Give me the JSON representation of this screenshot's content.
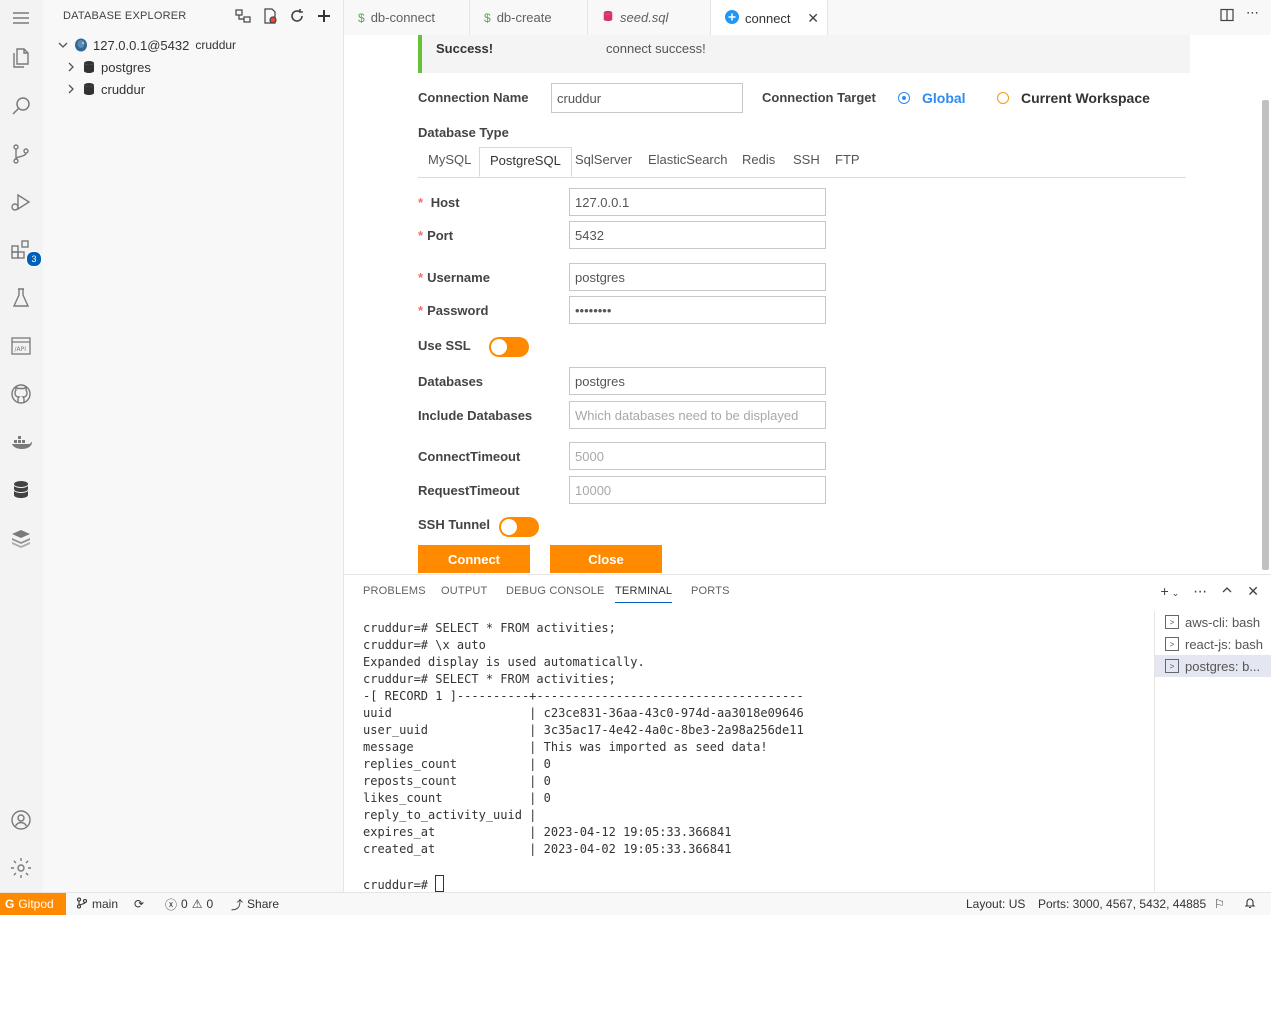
{
  "sidebar": {
    "title": "DATABASE EXPLORER",
    "connection": {
      "host": "127.0.0.1@5432",
      "db": "cruddur"
    },
    "children": [
      "postgres",
      "cruddur"
    ]
  },
  "tabs": [
    {
      "label": "db-connect",
      "icon": "dollar-icon",
      "active": false
    },
    {
      "label": "db-create",
      "icon": "dollar-icon",
      "active": false
    },
    {
      "label": "seed.sql",
      "icon": "database-icon",
      "active": false
    },
    {
      "label": "connect",
      "icon": "plus-circle-icon",
      "active": true
    }
  ],
  "activity_badge": "3",
  "alert": {
    "title": "Success!",
    "message": "connect success!"
  },
  "form": {
    "connection_name_label": "Connection Name",
    "connection_name_value": "cruddur",
    "connection_target_label": "Connection Target",
    "target_global": "Global",
    "target_workspace": "Current Workspace",
    "database_type_label": "Database Type",
    "db_types": [
      "MySQL",
      "PostgreSQL",
      "SqlServer",
      "ElasticSearch",
      "Redis",
      "SSH",
      "FTP"
    ],
    "active_db_type": "PostgreSQL",
    "host_label": "Host",
    "host_value": "127.0.0.1",
    "port_label": "Port",
    "port_value": "5432",
    "username_label": "Username",
    "username_value": "postgres",
    "password_label": "Password",
    "password_value": "••••••••",
    "ssl_label": "Use SSL",
    "databases_label": "Databases",
    "databases_value": "postgres",
    "include_label": "Include Databases",
    "include_placeholder": "Which databases need to be displayed",
    "connect_timeout_label": "ConnectTimeout",
    "connect_timeout_value": "5000",
    "request_timeout_label": "RequestTimeout",
    "request_timeout_value": "10000",
    "ssh_label": "SSH Tunnel",
    "connect_button": "Connect",
    "close_button": "Close"
  },
  "panel": {
    "tabs": [
      "PROBLEMS",
      "OUTPUT",
      "DEBUG CONSOLE",
      "TERMINAL",
      "PORTS"
    ],
    "active_tab": "TERMINAL",
    "terminal_lines": [
      "cruddur=# SELECT * FROM activities;",
      "cruddur=# \\x auto",
      "Expanded display is used automatically.",
      "cruddur=# SELECT * FROM activities;",
      "-[ RECORD 1 ]----------+-------------------------------------",
      "uuid                   | c23ce831-36aa-43c0-974d-aa3018e09646",
      "user_uuid              | 3c35ac17-4e42-4a0c-8be3-2a98a256de11",
      "message                | This was imported as seed data!",
      "replies_count          | 0",
      "reposts_count          | 0",
      "likes_count            | 0",
      "reply_to_activity_uuid | ",
      "expires_at             | 2023-04-12 19:05:33.366841",
      "created_at             | 2023-04-02 19:05:33.366841",
      ""
    ],
    "prompt": "cruddur=# ",
    "terminals": [
      "aws-cli: bash",
      "react-js: bash",
      "postgres: b..."
    ]
  },
  "status": {
    "gitpod": "Gitpod",
    "branch": "main",
    "errors": "0",
    "warnings": "0",
    "share": "Share",
    "layout": "Layout: US",
    "ports": "Ports: 3000, 4567, 5432, 44885"
  }
}
